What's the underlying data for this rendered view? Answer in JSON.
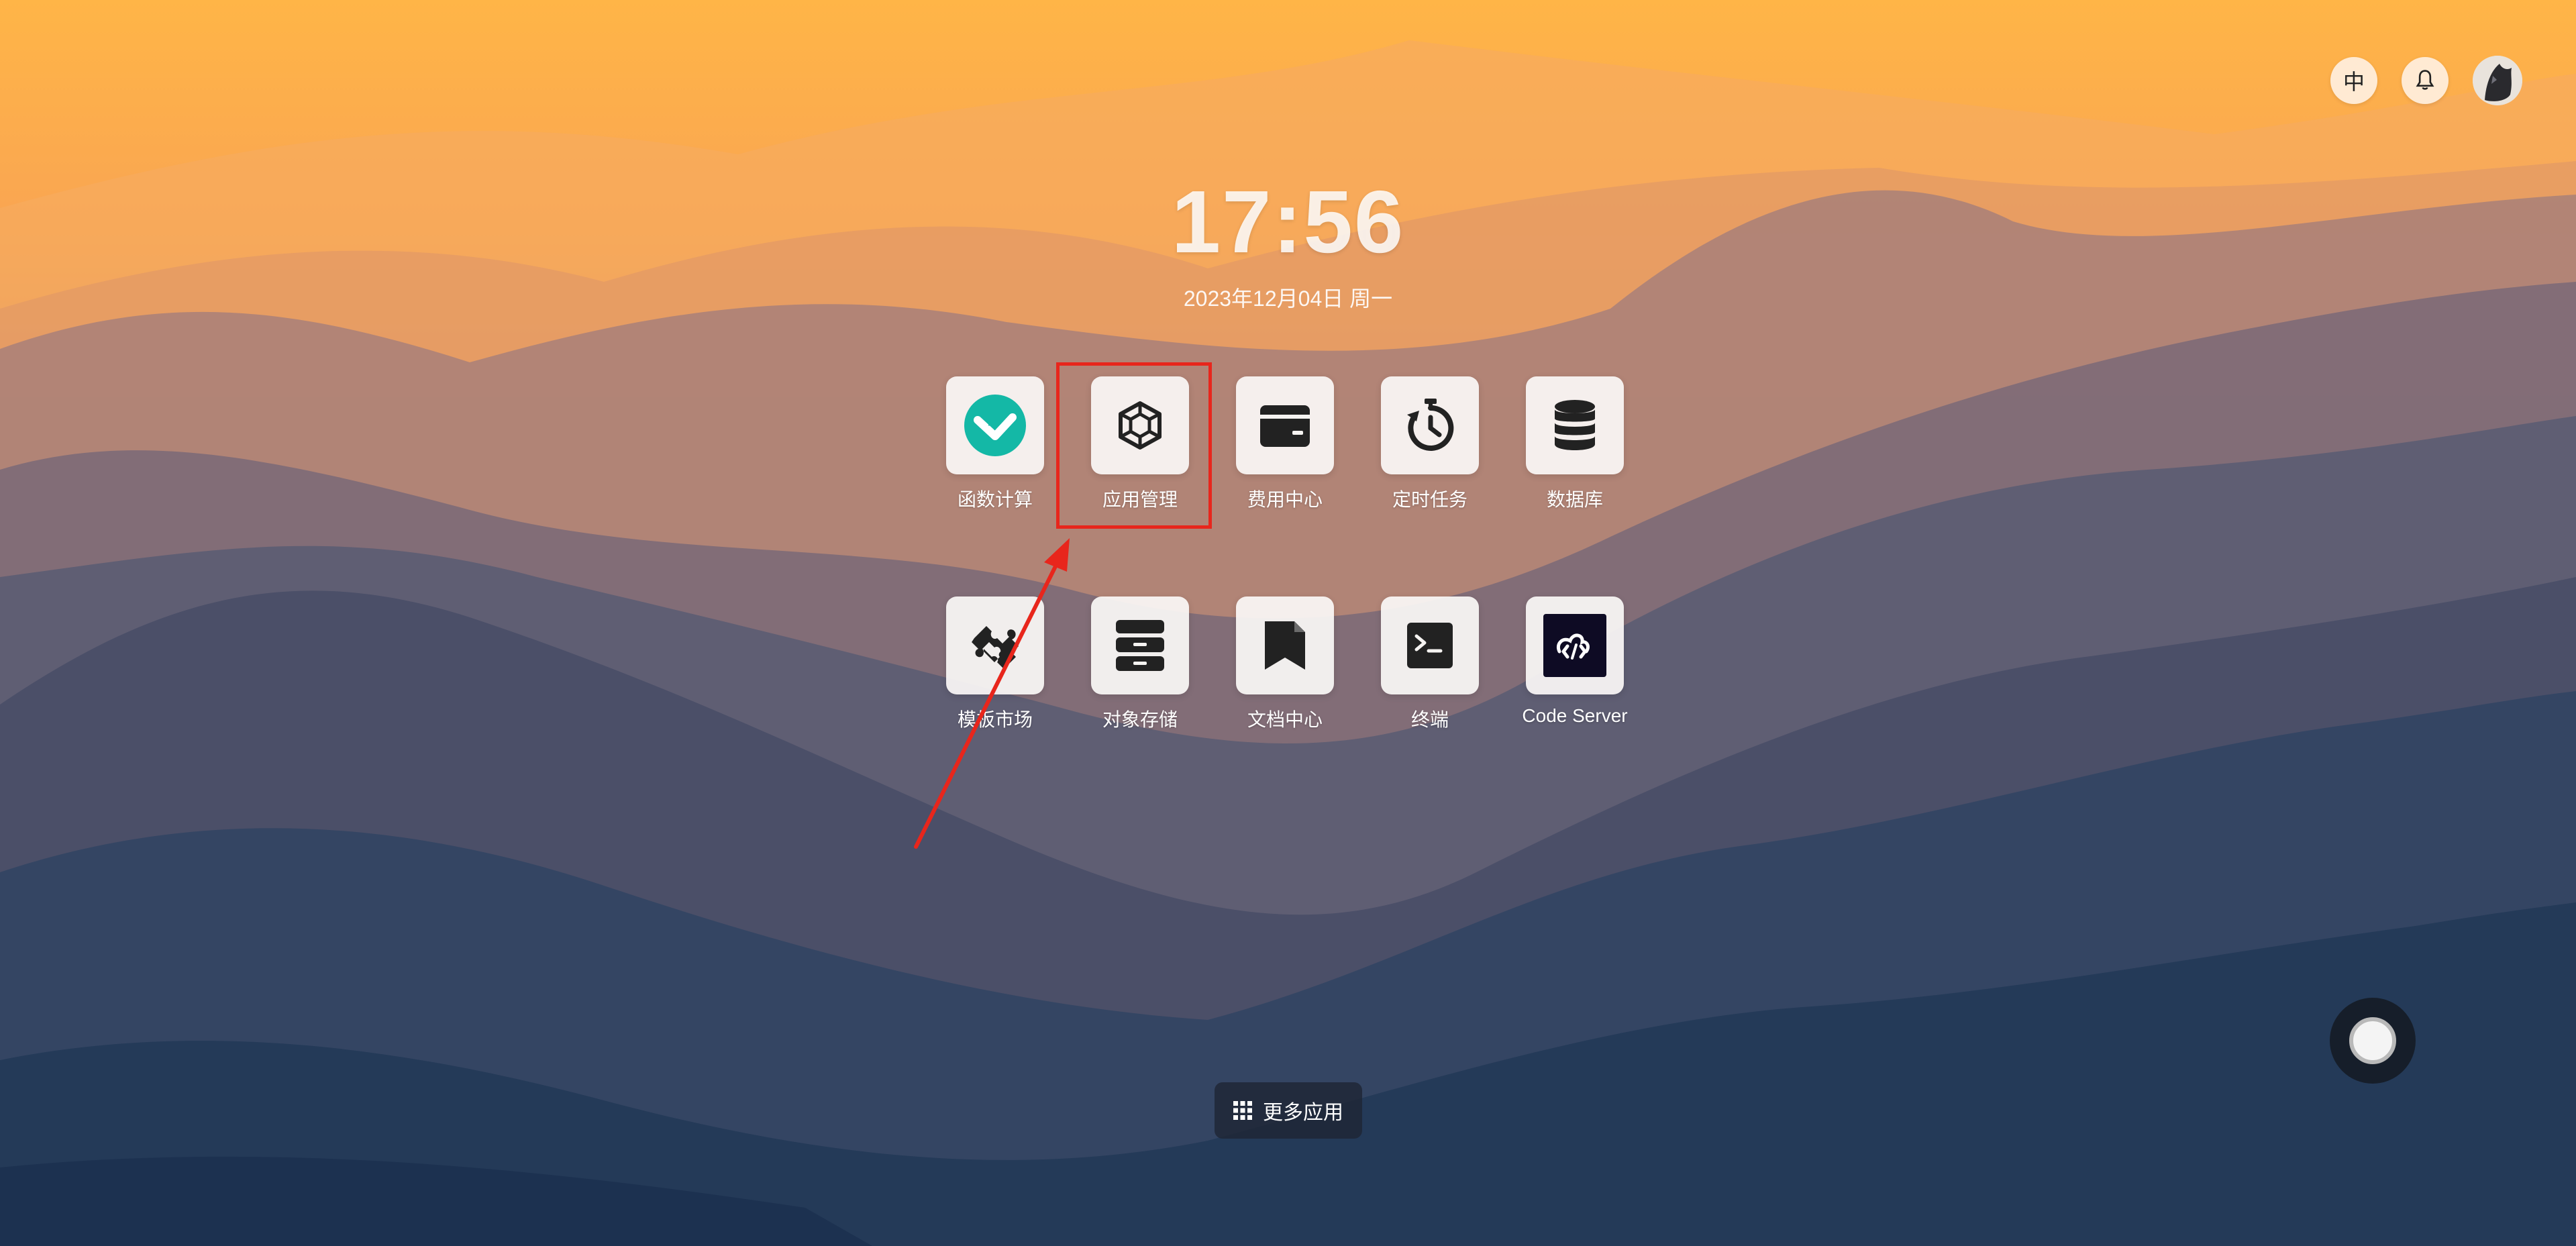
{
  "header": {
    "language_label": "中",
    "bell_icon": "bell-icon",
    "avatar_icon": "user-avatar"
  },
  "clock": {
    "time": "17:56",
    "date": "2023年12月04日 周一"
  },
  "apps": [
    {
      "label": "函数计算",
      "icon": "function-compute-icon"
    },
    {
      "label": "应用管理",
      "icon": "app-management-icon"
    },
    {
      "label": "费用中心",
      "icon": "wallet-icon"
    },
    {
      "label": "定时任务",
      "icon": "timer-icon"
    },
    {
      "label": "数据库",
      "icon": "database-icon"
    },
    {
      "label": "模板市场",
      "icon": "puzzle-icon"
    },
    {
      "label": "对象存储",
      "icon": "storage-cabinet-icon"
    },
    {
      "label": "文档中心",
      "icon": "bookmark-doc-icon"
    },
    {
      "label": "终端",
      "icon": "terminal-icon"
    },
    {
      "label": "Code Server",
      "icon": "code-server-icon"
    }
  ],
  "footer": {
    "more_apps_label": "更多应用"
  },
  "colors": {
    "highlight": "#e8261c",
    "function_accent": "#14b8a6"
  }
}
